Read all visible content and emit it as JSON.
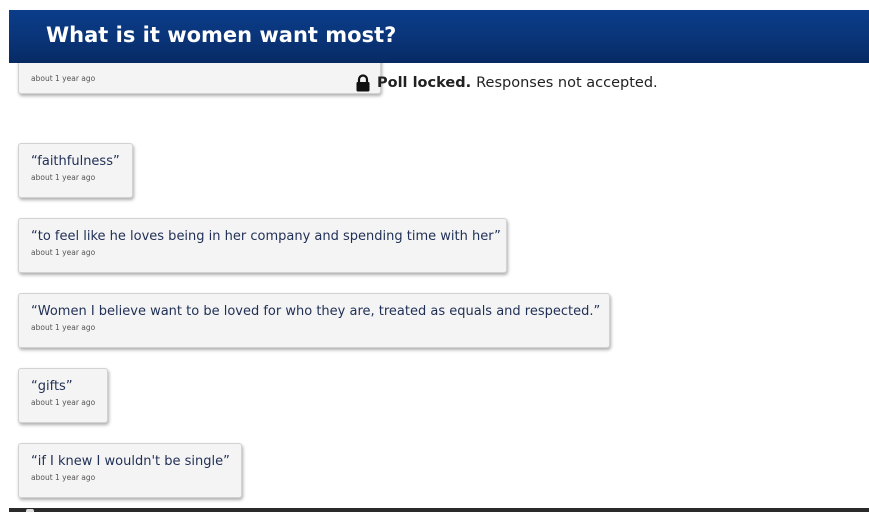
{
  "poll": {
    "title": "What is it women want most?"
  },
  "lock_banner": {
    "icon": "lock-icon",
    "strong_text": "Poll locked.",
    "text": "Responses not accepted."
  },
  "responses": [
    {
      "text": "",
      "time": "about 1 year ago"
    },
    {
      "text": "“faithfulness”",
      "time": "about 1 year ago"
    },
    {
      "text": "“to feel like he loves being in her company and spending time with her”",
      "time": "about 1 year ago"
    },
    {
      "text": "“Women I believe want to be loved for who they are, treated as equals and respected.”",
      "time": "about 1 year ago"
    },
    {
      "text": "“gifts”",
      "time": "about 1 year ago"
    },
    {
      "text": "“if I knew I wouldn't be single”",
      "time": "about 1 year ago"
    }
  ],
  "colors": {
    "header_bg": "#0a3478",
    "header_text": "#ffffff",
    "card_bg": "#f4f4f4",
    "response_text": "#1f2f55"
  }
}
